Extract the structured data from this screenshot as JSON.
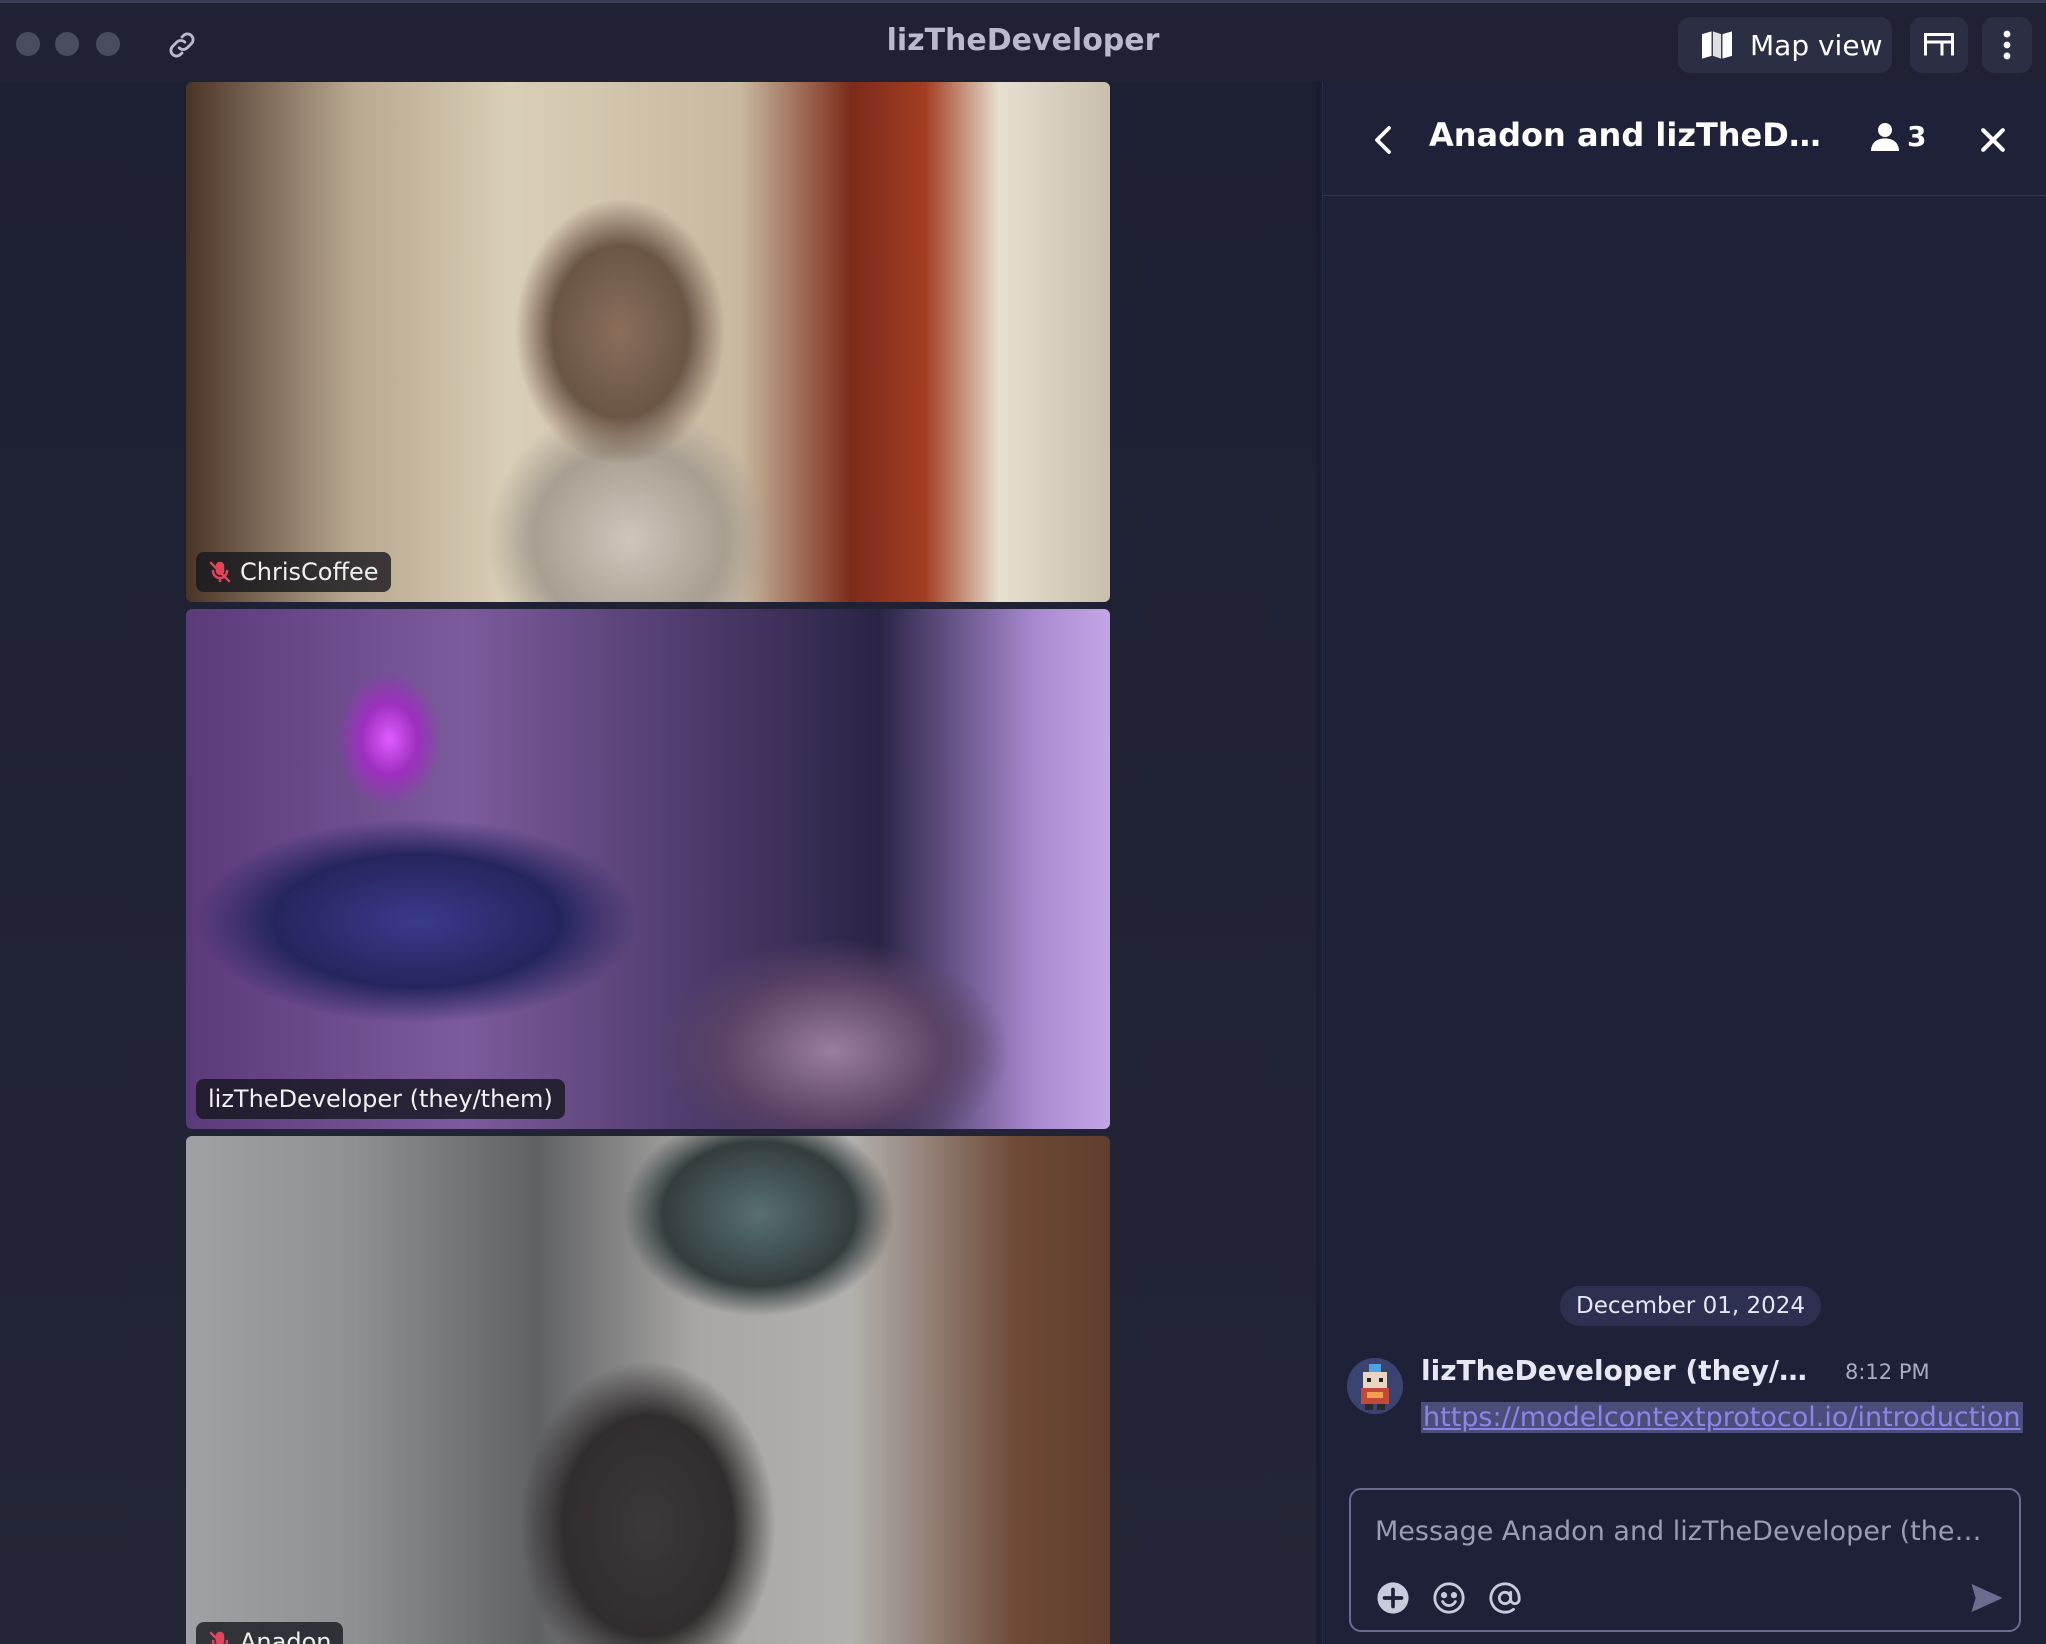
{
  "window": {
    "title": "lizTheDeveloper"
  },
  "toolbar": {
    "map_view_label": "Map view",
    "link_icon": "link-icon",
    "map_icon": "map-icon",
    "desk_icon": "desk-icon",
    "more_icon": "more-vertical-icon"
  },
  "videos": [
    {
      "name": "ChrisCoffee",
      "muted": true
    },
    {
      "name": "lizTheDeveloper (they/them)",
      "muted": false
    },
    {
      "name": "Anadon",
      "muted": true
    }
  ],
  "chat": {
    "title": "Anadon and lizTheDeveloper (they/them)",
    "member_count": "3",
    "date_separator": "December 01, 2024",
    "messages": [
      {
        "sender": "lizTheDeveloper (they/them)",
        "time": "8:12 PM",
        "text": "https://modelcontextprotocol.io/introduction"
      }
    ],
    "composer_placeholder": "Message Anadon and lizTheDeveloper (they/them)"
  },
  "colors": {
    "background": "#1b1d2e",
    "panel": "#1f2138",
    "accent_link": "#8a85e6",
    "muted_icon": "#e0455a"
  }
}
